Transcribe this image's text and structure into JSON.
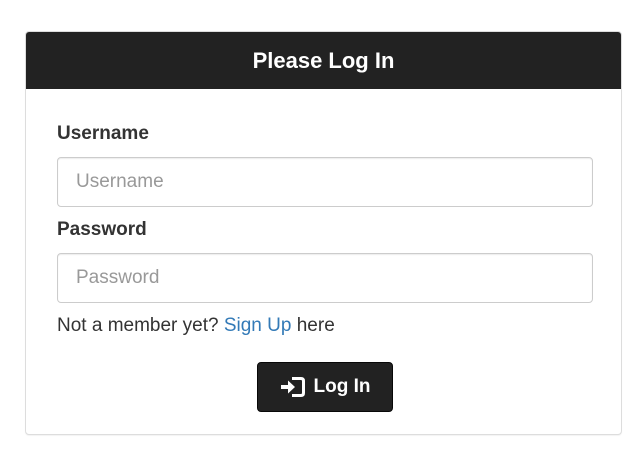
{
  "panel": {
    "title": "Please Log In"
  },
  "form": {
    "username": {
      "label": "Username",
      "placeholder": "Username",
      "value": ""
    },
    "password": {
      "label": "Password",
      "placeholder": "Password",
      "value": ""
    },
    "signup": {
      "prefix": "Not a member yet? ",
      "link_text": "Sign Up",
      "suffix": " here"
    },
    "submit": {
      "label": "Log In",
      "icon": "log-in-icon"
    }
  },
  "colors": {
    "heading_bg": "#222222",
    "heading_text": "#ffffff",
    "link": "#337ab7",
    "button_bg": "#222222"
  }
}
